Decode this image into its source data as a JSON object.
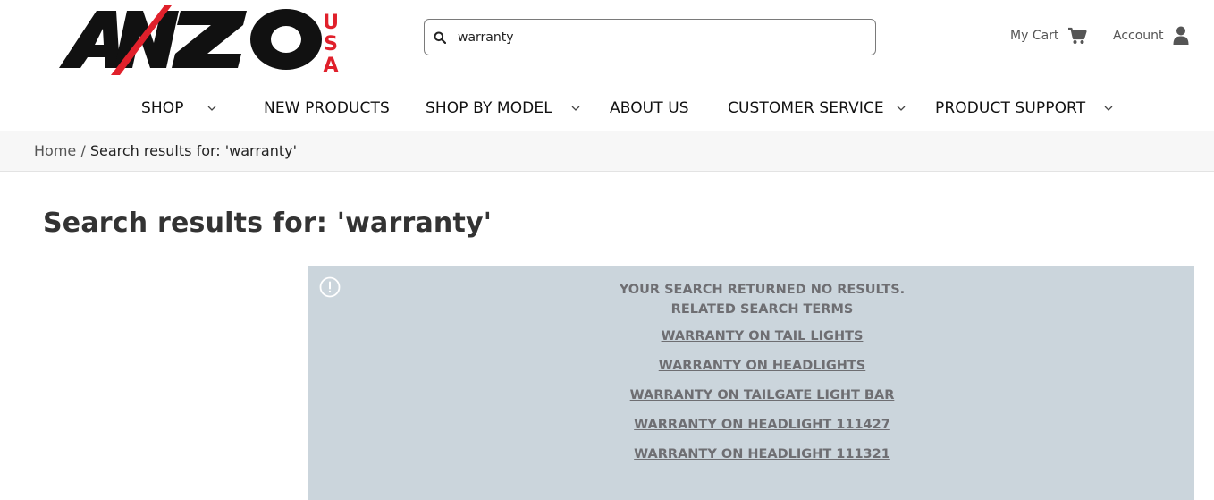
{
  "header": {
    "search": {
      "value": "warranty",
      "placeholder": ""
    },
    "cart_label": "My Cart",
    "account_label": "Account"
  },
  "logo": {
    "brand_text": "ANZO",
    "sub_text": "USA",
    "colors": {
      "primary": "#111111",
      "accent": "#e0202b"
    }
  },
  "nav": {
    "items": [
      {
        "label": "SHOP",
        "has_dropdown": true
      },
      {
        "label": "NEW PRODUCTS",
        "has_dropdown": false
      },
      {
        "label": "SHOP BY MODEL",
        "has_dropdown": true
      },
      {
        "label": "ABOUT US",
        "has_dropdown": false
      },
      {
        "label": "CUSTOMER SERVICE",
        "has_dropdown": true
      },
      {
        "label": "PRODUCT SUPPORT",
        "has_dropdown": true
      }
    ]
  },
  "breadcrumb": {
    "home": "Home",
    "separator": " / ",
    "current": "Search results for: 'warranty'"
  },
  "page": {
    "title": "Search results for: 'warranty'"
  },
  "notice": {
    "message_line1": "YOUR SEARCH RETURNED NO RESULTS.",
    "message_line2": "RELATED SEARCH TERMS",
    "related_terms": [
      "WARRANTY ON TAIL LIGHTS",
      "WARRANTY ON HEADLIGHTS",
      "WARRANTY ON TAILGATE LIGHT BAR",
      "WARRANTY ON HEADLIGHT 111427",
      "WARRANTY ON HEADLIGHT 111321"
    ],
    "background_color": "#cbd5dc"
  },
  "icons": {
    "search": "search-icon",
    "cart": "cart-icon",
    "account": "user-icon",
    "dropdown": "chevron-down-icon",
    "notice": "info-circle-icon"
  }
}
